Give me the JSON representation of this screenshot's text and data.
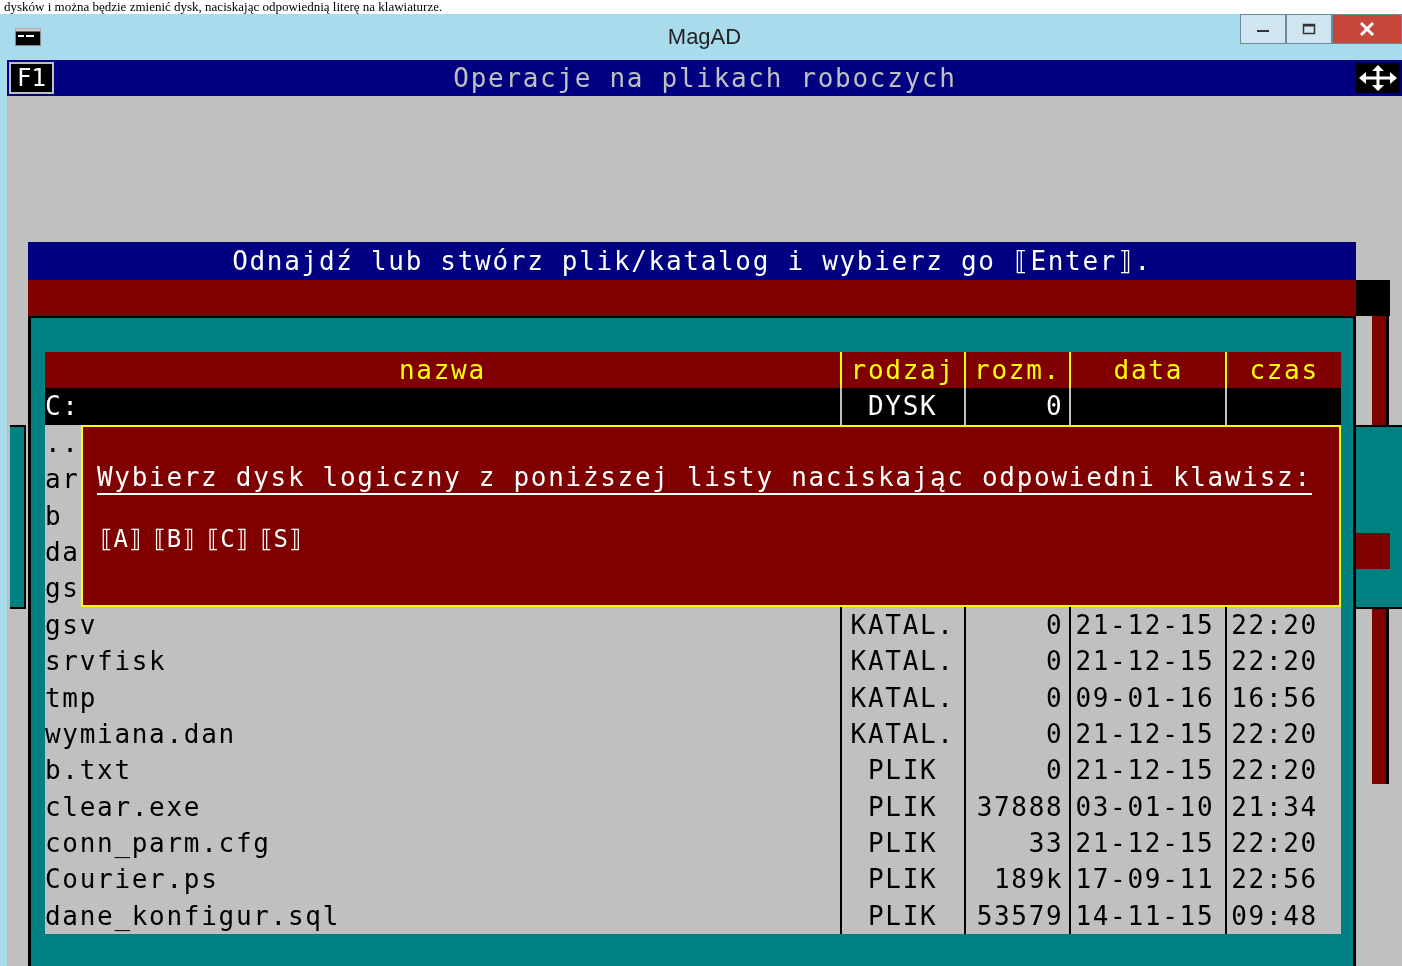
{
  "caption": "dysków i można będzie zmienić dysk, naciskając odpowiednią literę na klawiaturze.",
  "window": {
    "title": "MagAD"
  },
  "menu_bar": {
    "key": "F1",
    "title": "Operacje na plikach roboczych"
  },
  "dialog": {
    "title": "Odnajdź lub stwórz plik/katalog i wybierz go ⟦Enter⟧.",
    "table": {
      "columns": [
        "nazwa",
        "rodzaj",
        "rozm.",
        "data",
        "czas"
      ],
      "rows": [
        {
          "name": "C:",
          "type": "DYSK",
          "size": "0",
          "selected": true
        },
        {
          "name": "..",
          "selected": false
        },
        {
          "name": "ar",
          "selected": false
        },
        {
          "name": "b",
          "selected": false
        },
        {
          "name": "da",
          "selected": false
        },
        {
          "name": "gs",
          "selected": false
        },
        {
          "name": "gsv",
          "type": "KATAL.",
          "size": "0",
          "date": "21-12-15",
          "time": "22:20",
          "selected": false
        },
        {
          "name": "srvfisk",
          "type": "KATAL.",
          "size": "0",
          "date": "21-12-15",
          "time": "22:20",
          "selected": false
        },
        {
          "name": "tmp",
          "type": "KATAL.",
          "size": "0",
          "date": "09-01-16",
          "time": "16:56",
          "selected": false
        },
        {
          "name": "wymiana.dan",
          "type": "KATAL.",
          "size": "0",
          "date": "21-12-15",
          "time": "22:20",
          "selected": false
        },
        {
          "name": "b.txt",
          "type": "PLIK",
          "size": "0",
          "date": "21-12-15",
          "time": "22:20",
          "selected": false
        },
        {
          "name": "clear.exe",
          "type": "PLIK",
          "size": "37888",
          "date": "03-01-10",
          "time": "21:34",
          "selected": false
        },
        {
          "name": "conn_parm.cfg",
          "type": "PLIK",
          "size": "33",
          "date": "21-12-15",
          "time": "22:20",
          "selected": false
        },
        {
          "name": "Courier.ps",
          "type": "PLIK",
          "size": "189k",
          "date": "17-09-11",
          "time": "22:56",
          "selected": false
        },
        {
          "name": "dane_konfigur.sql",
          "type": "PLIK",
          "size": "53579",
          "date": "14-11-15",
          "time": "09:48",
          "selected": false
        }
      ]
    }
  },
  "drive_popup": {
    "message": "Wybierz dysk logiczny z poniższej listy naciskając odpowiedni klawisz:",
    "keys": [
      "⟦A⟧",
      "⟦B⟧",
      "⟦C⟧",
      "⟦S⟧"
    ]
  }
}
